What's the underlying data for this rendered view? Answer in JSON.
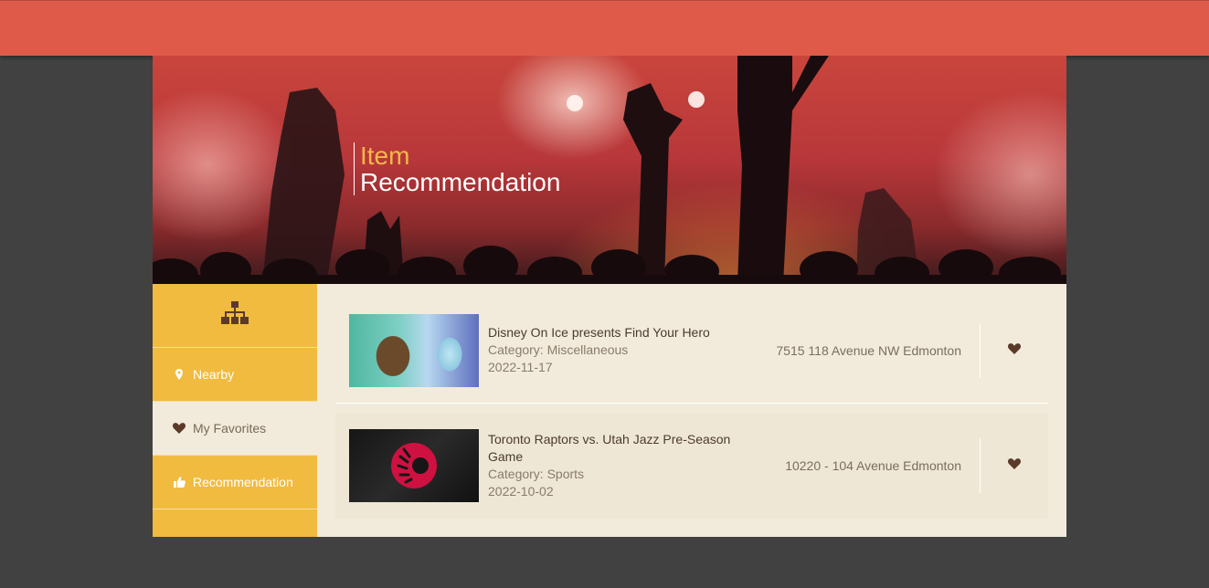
{
  "header": {
    "title_line1": "Item",
    "title_line2": "Recommendation"
  },
  "sidebar": {
    "logo_icon": "sitemap-icon",
    "items": [
      {
        "label": "Nearby",
        "icon": "map-marker-icon",
        "active": false
      },
      {
        "label": "My Favorites",
        "icon": "heart-icon",
        "active": true
      },
      {
        "label": "Recommendation",
        "icon": "thumbs-up-icon",
        "active": false
      }
    ]
  },
  "items": [
    {
      "name": "Disney On Ice presents Find Your Hero",
      "category": "Category: Miscellaneous",
      "date": "2022-11-17",
      "address": "7515 118 Avenue NW Edmonton",
      "favorite_icon": "heart-icon"
    },
    {
      "name": "Toronto Raptors vs. Utah Jazz Pre-Season Game",
      "category": "Category: Sports",
      "date": "2022-10-02",
      "address": "10220 - 104 Avenue Edmonton",
      "favorite_icon": "heart-icon"
    }
  ],
  "colors": {
    "topbar": "#e05a4a",
    "sidebar": "#f1bb40",
    "content_bg": "#f2ebdb",
    "page_bg": "#414141",
    "accent_title": "#f3b94a",
    "icon_brown": "#5b3a2a"
  }
}
